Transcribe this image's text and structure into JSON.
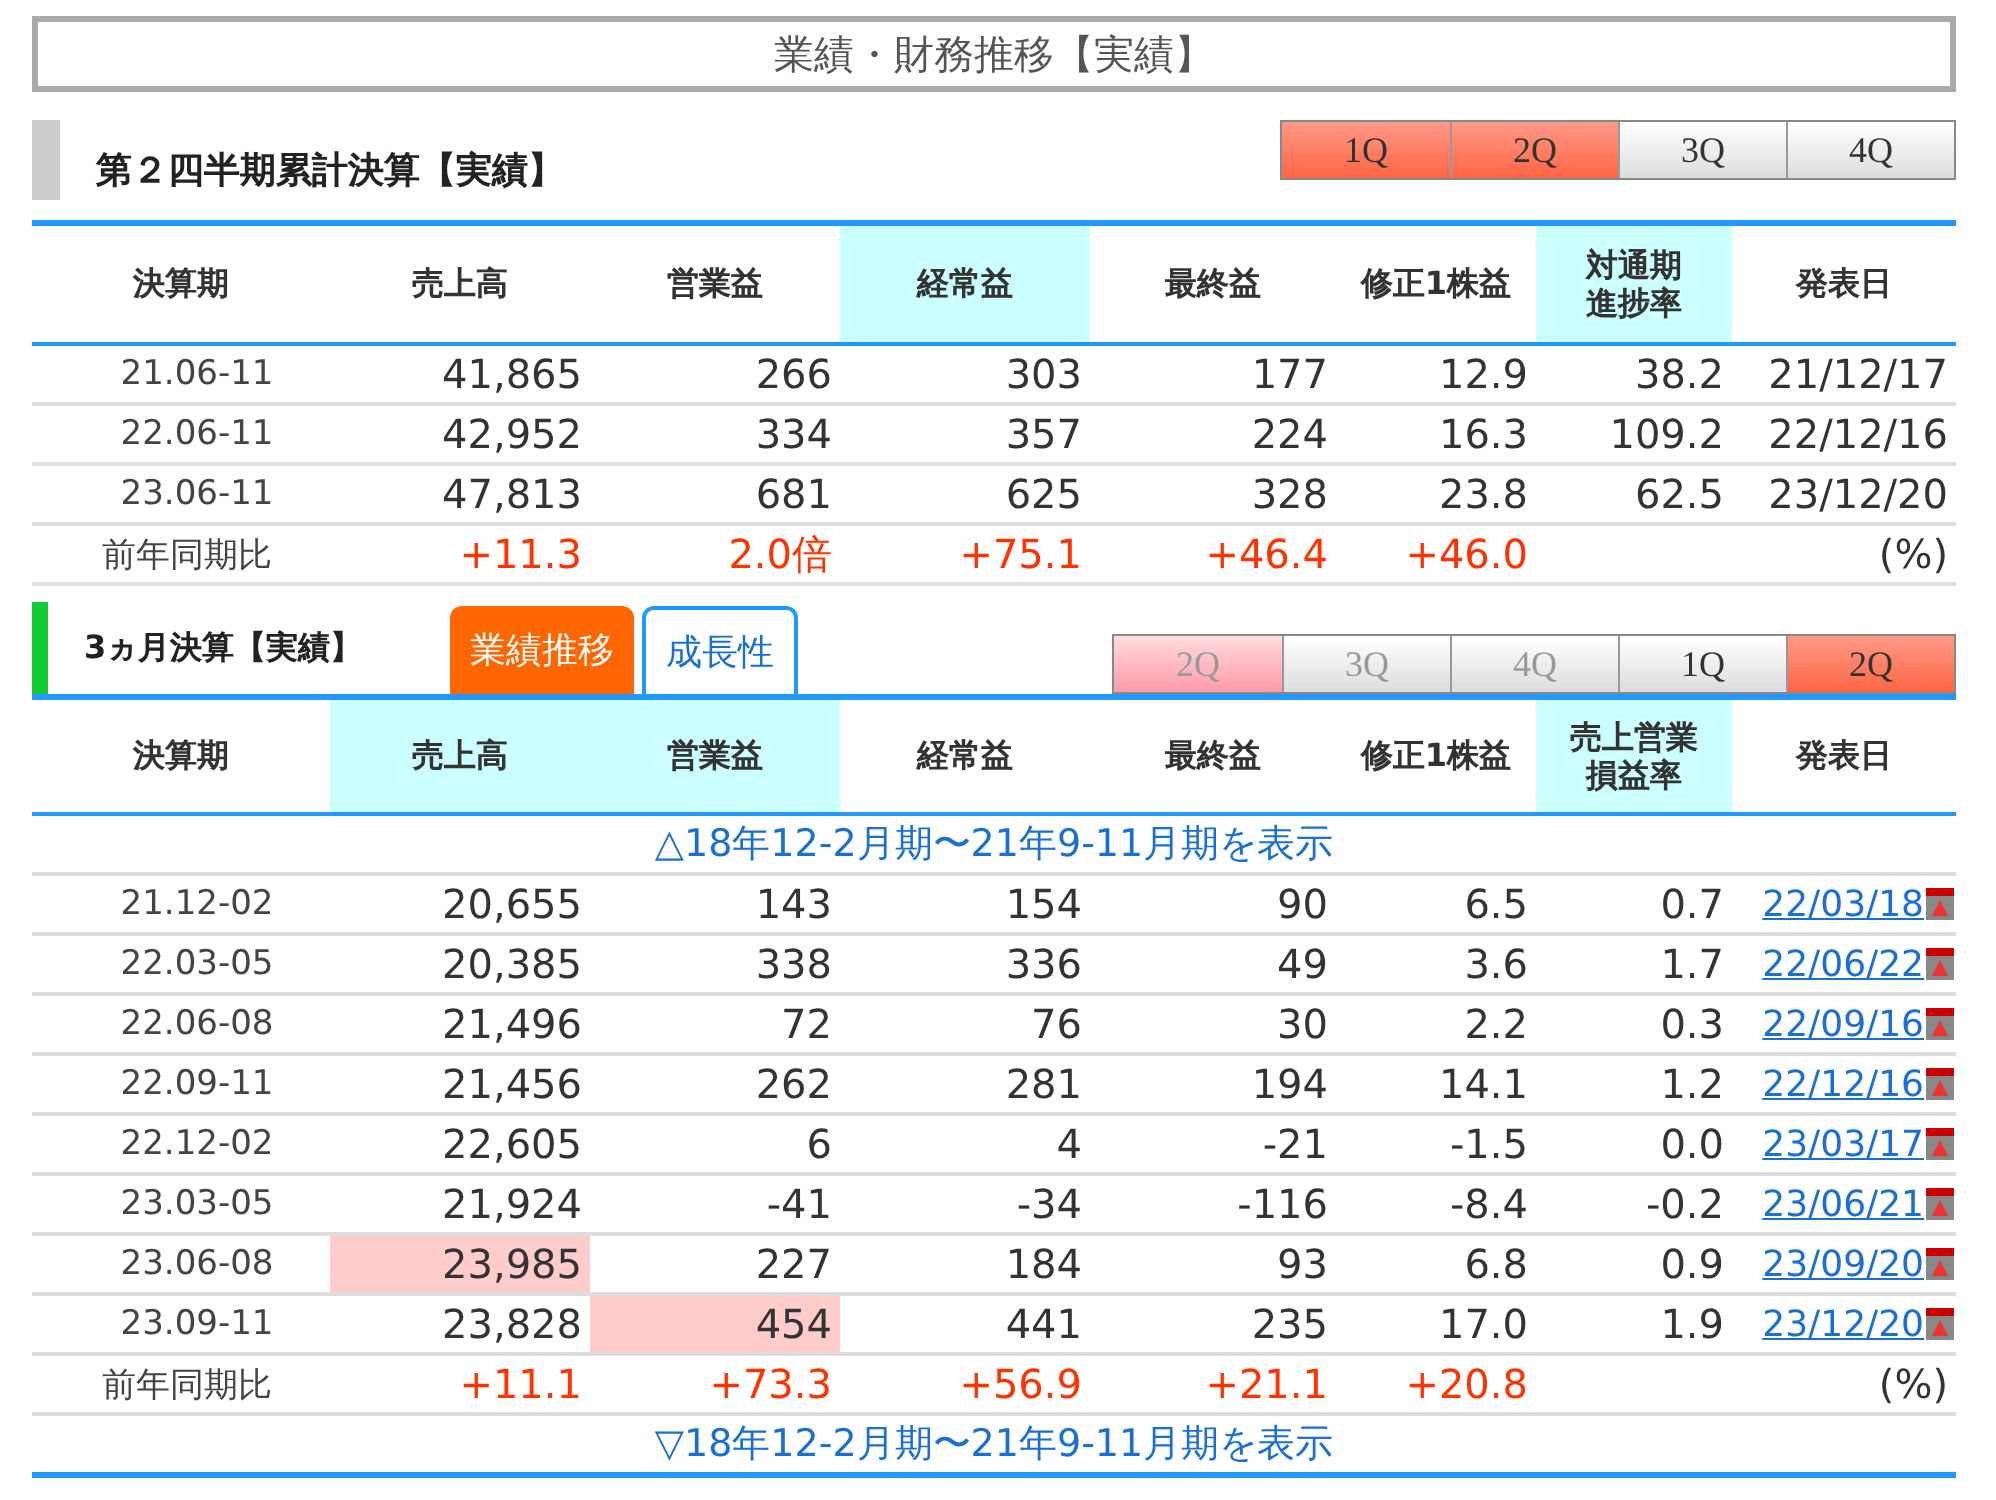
{
  "title": "業績・財務推移【実績】",
  "cumulative": {
    "heading": "第２四半期累計決算【実績】",
    "quarters": [
      {
        "label": "1Q",
        "selected": true,
        "disabled": false
      },
      {
        "label": "2Q",
        "selected": true,
        "disabled": false
      },
      {
        "label": "3Q",
        "selected": false,
        "disabled": false
      },
      {
        "label": "4Q",
        "selected": false,
        "disabled": false
      }
    ],
    "columns": [
      {
        "lines": [
          "決算期"
        ],
        "highlighted": false
      },
      {
        "lines": [
          "売上高"
        ],
        "highlighted": false
      },
      {
        "lines": [
          "営業益"
        ],
        "highlighted": false
      },
      {
        "lines": [
          "経常益"
        ],
        "highlighted": true
      },
      {
        "lines": [
          "最終益"
        ],
        "highlighted": false
      },
      {
        "lines": [
          "修正1株益"
        ],
        "highlighted": false
      },
      {
        "lines": [
          "対通期",
          "進捗率"
        ],
        "highlighted": true
      },
      {
        "lines": [
          "発表日"
        ],
        "highlighted": false
      }
    ],
    "rows": [
      {
        "cells": [
          {
            "text": "21.06-11",
            "highlighted": false
          },
          {
            "text": "41,865",
            "highlighted": false
          },
          {
            "text": "266",
            "highlighted": false
          },
          {
            "text": "303",
            "highlighted": false
          },
          {
            "text": "177",
            "highlighted": false
          },
          {
            "text": "12.9",
            "highlighted": false
          },
          {
            "text": "38.2",
            "highlighted": false
          },
          {
            "text": "21/12/17",
            "highlighted": false
          }
        ]
      },
      {
        "cells": [
          {
            "text": "22.06-11",
            "highlighted": false
          },
          {
            "text": "42,952",
            "highlighted": false
          },
          {
            "text": "334",
            "highlighted": false
          },
          {
            "text": "357",
            "highlighted": false
          },
          {
            "text": "224",
            "highlighted": false
          },
          {
            "text": "16.3",
            "highlighted": false
          },
          {
            "text": "109.2",
            "highlighted": false
          },
          {
            "text": "22/12/16",
            "highlighted": false
          }
        ]
      },
      {
        "cells": [
          {
            "text": "23.06-11",
            "highlighted": false
          },
          {
            "text": "47,813",
            "highlighted": false
          },
          {
            "text": "681",
            "highlighted": false
          },
          {
            "text": "625",
            "highlighted": false
          },
          {
            "text": "328",
            "highlighted": false
          },
          {
            "text": "23.8",
            "highlighted": false
          },
          {
            "text": "62.5",
            "highlighted": false
          },
          {
            "text": "23/12/20",
            "highlighted": false
          }
        ]
      }
    ],
    "yoy": {
      "label": "前年同期比",
      "values": [
        "+11.3",
        "2.0倍",
        "+75.1",
        "+46.4",
        "+46.0"
      ],
      "unit": "(%)"
    }
  },
  "quarterly": {
    "heading": "3ヵ月決算【実績】",
    "tabs": [
      {
        "label": "業績推移",
        "selected": true
      },
      {
        "label": "成長性",
        "selected": false
      }
    ],
    "quarters": [
      {
        "label": "2Q",
        "selected": true,
        "disabled": true
      },
      {
        "label": "3Q",
        "selected": false,
        "disabled": true
      },
      {
        "label": "4Q",
        "selected": false,
        "disabled": true
      },
      {
        "label": "1Q",
        "selected": false,
        "disabled": false
      },
      {
        "label": "2Q",
        "selected": true,
        "disabled": false
      }
    ],
    "columns": [
      {
        "lines": [
          "決算期"
        ],
        "highlighted": false
      },
      {
        "lines": [
          "売上高"
        ],
        "highlighted": true
      },
      {
        "lines": [
          "営業益"
        ],
        "highlighted": true
      },
      {
        "lines": [
          "経常益"
        ],
        "highlighted": false
      },
      {
        "lines": [
          "最終益"
        ],
        "highlighted": false
      },
      {
        "lines": [
          "修正1株益"
        ],
        "highlighted": false
      },
      {
        "lines": [
          "売上営業",
          "損益率"
        ],
        "highlighted": true
      },
      {
        "lines": [
          "発表日"
        ],
        "highlighted": false
      }
    ],
    "show_earlier": "△18年12-2月期〜21年9-11月期を表示",
    "rows": [
      {
        "cells": [
          {
            "text": "21.12-02",
            "highlighted": false
          },
          {
            "text": "20,655",
            "highlighted": false
          },
          {
            "text": "143",
            "highlighted": false
          },
          {
            "text": "154",
            "highlighted": false
          },
          {
            "text": "90",
            "highlighted": false
          },
          {
            "text": "6.5",
            "highlighted": false
          },
          {
            "text": "0.7",
            "highlighted": false
          },
          {
            "text": "22/03/18",
            "highlighted": false
          }
        ]
      },
      {
        "cells": [
          {
            "text": "22.03-05",
            "highlighted": false
          },
          {
            "text": "20,385",
            "highlighted": false
          },
          {
            "text": "338",
            "highlighted": false
          },
          {
            "text": "336",
            "highlighted": false
          },
          {
            "text": "49",
            "highlighted": false
          },
          {
            "text": "3.6",
            "highlighted": false
          },
          {
            "text": "1.7",
            "highlighted": false
          },
          {
            "text": "22/06/22",
            "highlighted": false
          }
        ]
      },
      {
        "cells": [
          {
            "text": "22.06-08",
            "highlighted": false
          },
          {
            "text": "21,496",
            "highlighted": false
          },
          {
            "text": "72",
            "highlighted": false
          },
          {
            "text": "76",
            "highlighted": false
          },
          {
            "text": "30",
            "highlighted": false
          },
          {
            "text": "2.2",
            "highlighted": false
          },
          {
            "text": "0.3",
            "highlighted": false
          },
          {
            "text": "22/09/16",
            "highlighted": false
          }
        ]
      },
      {
        "cells": [
          {
            "text": "22.09-11",
            "highlighted": false
          },
          {
            "text": "21,456",
            "highlighted": false
          },
          {
            "text": "262",
            "highlighted": false
          },
          {
            "text": "281",
            "highlighted": false
          },
          {
            "text": "194",
            "highlighted": false
          },
          {
            "text": "14.1",
            "highlighted": false
          },
          {
            "text": "1.2",
            "highlighted": false
          },
          {
            "text": "22/12/16",
            "highlighted": false
          }
        ]
      },
      {
        "cells": [
          {
            "text": "22.12-02",
            "highlighted": false
          },
          {
            "text": "22,605",
            "highlighted": false
          },
          {
            "text": "6",
            "highlighted": false
          },
          {
            "text": "4",
            "highlighted": false
          },
          {
            "text": "-21",
            "highlighted": false
          },
          {
            "text": "-1.5",
            "highlighted": false
          },
          {
            "text": "0.0",
            "highlighted": false
          },
          {
            "text": "23/03/17",
            "highlighted": false
          }
        ]
      },
      {
        "cells": [
          {
            "text": "23.03-05",
            "highlighted": false
          },
          {
            "text": "21,924",
            "highlighted": false
          },
          {
            "text": "-41",
            "highlighted": false
          },
          {
            "text": "-34",
            "highlighted": false
          },
          {
            "text": "-116",
            "highlighted": false
          },
          {
            "text": "-8.4",
            "highlighted": false
          },
          {
            "text": "-0.2",
            "highlighted": false
          },
          {
            "text": "23/06/21",
            "highlighted": false
          }
        ]
      },
      {
        "cells": [
          {
            "text": "23.06-08",
            "highlighted": false
          },
          {
            "text": "23,985",
            "highlighted": true
          },
          {
            "text": "227",
            "highlighted": false
          },
          {
            "text": "184",
            "highlighted": false
          },
          {
            "text": "93",
            "highlighted": false
          },
          {
            "text": "6.8",
            "highlighted": false
          },
          {
            "text": "0.9",
            "highlighted": false
          },
          {
            "text": "23/09/20",
            "highlighted": false
          }
        ]
      },
      {
        "cells": [
          {
            "text": "23.09-11",
            "highlighted": false
          },
          {
            "text": "23,828",
            "highlighted": false
          },
          {
            "text": "454",
            "highlighted": true
          },
          {
            "text": "441",
            "highlighted": false
          },
          {
            "text": "235",
            "highlighted": false
          },
          {
            "text": "17.0",
            "highlighted": false
          },
          {
            "text": "1.9",
            "highlighted": false
          },
          {
            "text": "23/12/20",
            "highlighted": false
          }
        ]
      }
    ],
    "yoy": {
      "label": "前年同期比",
      "values": [
        "+11.1",
        "+73.3",
        "+56.9",
        "+21.1",
        "+20.8"
      ],
      "unit": "(%)"
    },
    "show_later": "▽18年12-2月期〜21年9-11月期を表示"
  }
}
